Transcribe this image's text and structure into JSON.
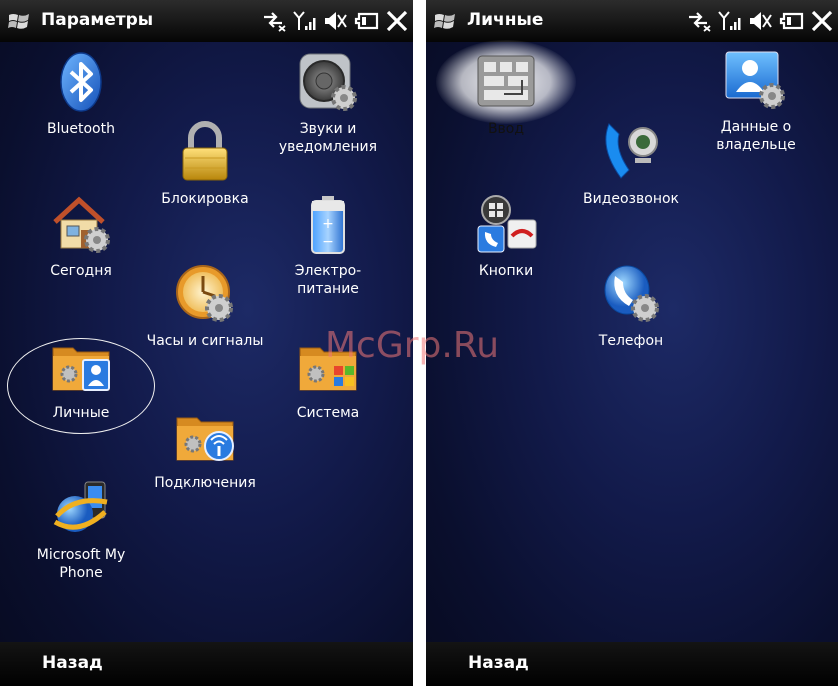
{
  "left_screen": {
    "title": "Параметры",
    "softkey": "Назад",
    "items": [
      {
        "label": "Bluetooth",
        "icon": "bluetooth-icon"
      },
      {
        "label": "Звуки и\nуведомления",
        "icon": "speaker-gear-icon"
      },
      {
        "label": "Блокировка",
        "icon": "padlock-icon"
      },
      {
        "label": "Сегодня",
        "icon": "house-gear-icon"
      },
      {
        "label": "Электро-\nпитание",
        "icon": "battery-icon"
      },
      {
        "label": "Часы и сигналы",
        "icon": "clock-gear-icon"
      },
      {
        "label": "Личные",
        "icon": "folder-person-icon"
      },
      {
        "label": "Система",
        "icon": "folder-windows-icon"
      },
      {
        "label": "Подключения",
        "icon": "folder-wireless-icon"
      },
      {
        "label": "Microsoft My\nPhone",
        "icon": "globe-phone-icon"
      }
    ]
  },
  "right_screen": {
    "title": "Личные",
    "softkey": "Назад",
    "items": [
      {
        "label": "Ввод",
        "icon": "keyboard-icon"
      },
      {
        "label": "Данные о\nвладельце",
        "icon": "contact-card-gear-icon"
      },
      {
        "label": "Видеозвонок",
        "icon": "video-call-icon"
      },
      {
        "label": "Кнопки",
        "icon": "buttons-icon"
      },
      {
        "label": "Телефон",
        "icon": "phone-gear-icon"
      }
    ]
  },
  "watermark": "McGrp.Ru",
  "colors": {
    "background": "#121a4a",
    "folder": "#e8a53a",
    "accent_blue": "#2a7be0"
  }
}
